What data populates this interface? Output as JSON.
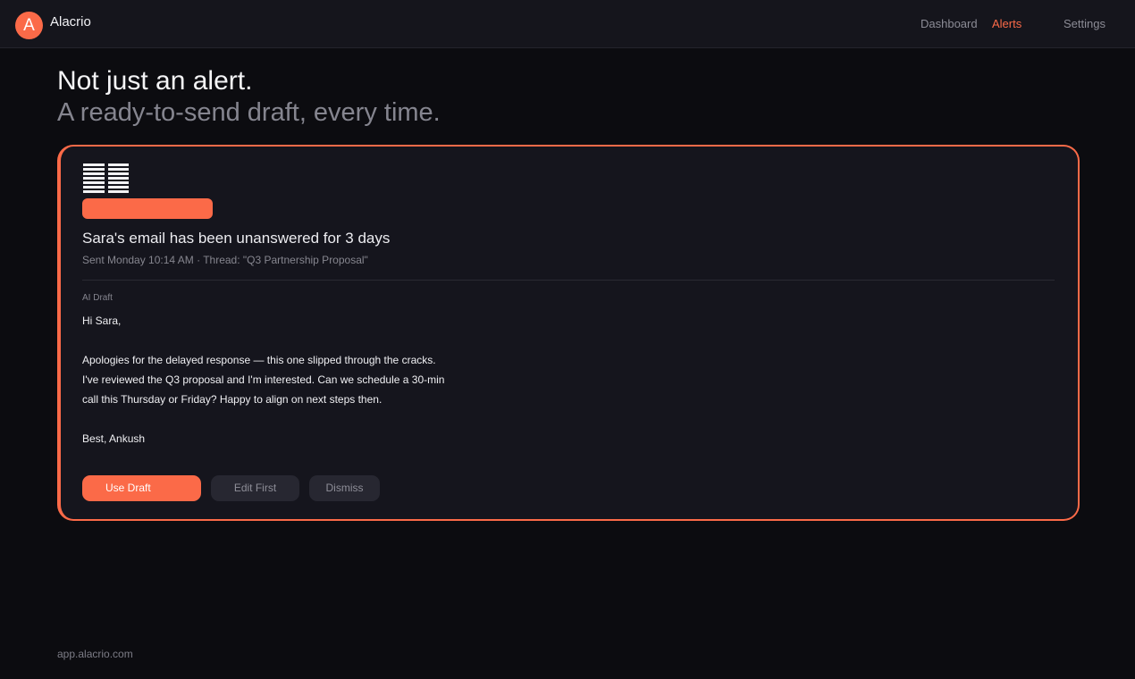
{
  "app": {
    "logo_letter": "A",
    "name": "Alacrio",
    "accent_color": "#fb6a48"
  },
  "nav": {
    "items": [
      {
        "label": "Dashboard",
        "active": false
      },
      {
        "label": "Alerts",
        "active": true
      },
      {
        "label": "Settings",
        "active": false
      }
    ]
  },
  "hero": {
    "headline": "Not just an alert.",
    "subheadline": "A ready-to-send draft, every time."
  },
  "alert_card": {
    "icon": "document-lines-icon",
    "title": "Sara's email has been unanswered for 3 days",
    "meta": "Sent Monday 10:14 AM · Thread: \"Q3 Partnership Proposal\"",
    "draft_label": "AI Draft",
    "draft_lines": [
      "Hi Sara,",
      "",
      "Apologies for the delayed response — this one slipped through the cracks.",
      "I've reviewed the Q3 proposal and I'm interested. Can we schedule a 30-min",
      "call this Thursday or Friday? Happy to align on next steps then.",
      "",
      "Best, Ankush"
    ],
    "actions": {
      "use": "Use Draft",
      "edit": "Edit First",
      "dismiss": "Dismiss"
    }
  },
  "footer": {
    "url": "app.alacrio.com"
  }
}
